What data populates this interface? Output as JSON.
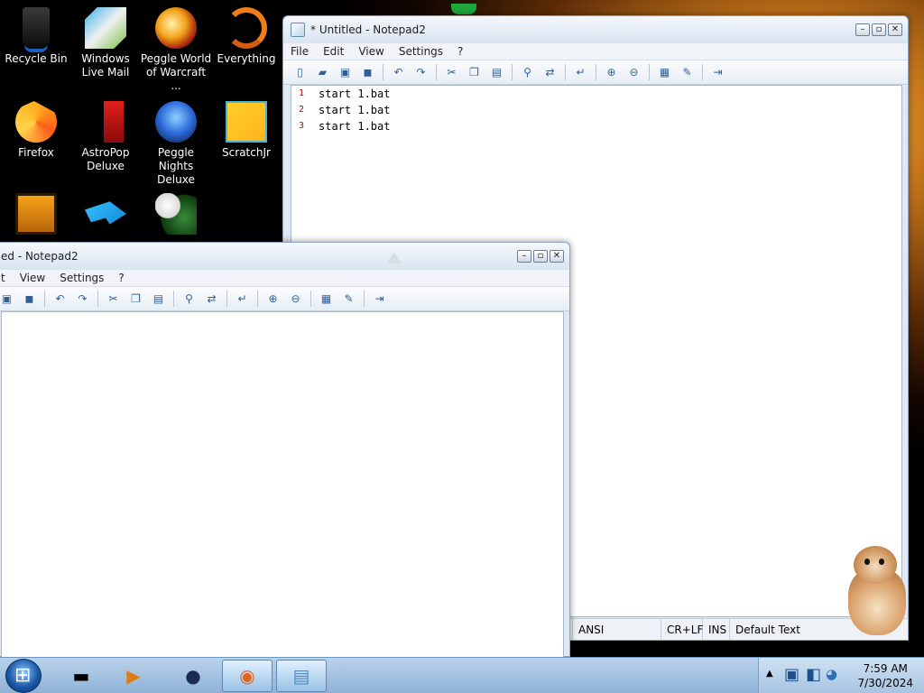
{
  "desktop": {
    "icons": [
      {
        "label": "Recycle Bin"
      },
      {
        "label": "Windows Live Mail"
      },
      {
        "label": "Peggle World of Warcraft ..."
      },
      {
        "label": "Everything"
      },
      {
        "label": "Firefox"
      },
      {
        "label": "AstroPop Deluxe"
      },
      {
        "label": "Peggle Nights Deluxe"
      },
      {
        "label": "ScratchJr"
      }
    ]
  },
  "window_front": {
    "title": "* Untitled - Notepad2",
    "menu": [
      "File",
      "Edit",
      "View",
      "Settings",
      "?"
    ],
    "lines": [
      {
        "num": "1",
        "text": "start 1.bat"
      },
      {
        "num": "2",
        "text": "start 1.bat"
      },
      {
        "num": "3",
        "text": "start 1.bat"
      }
    ],
    "status": {
      "encoding": "ANSI",
      "eol": "CR+LF",
      "mode": "INS",
      "scheme": "Default Text"
    }
  },
  "window_back": {
    "title": "ed - Notepad2",
    "menu": [
      "t",
      "View",
      "Settings",
      "?"
    ]
  },
  "taskbar": {
    "time": "7:59 AM",
    "date": "7/30/2024"
  }
}
